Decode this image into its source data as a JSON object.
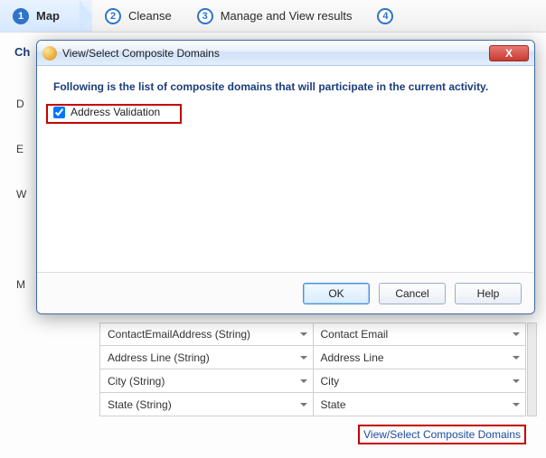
{
  "wizard": {
    "steps": [
      {
        "num": "1",
        "label": "Map"
      },
      {
        "num": "2",
        "label": "Cleanse"
      },
      {
        "num": "3",
        "label": "Manage and View results"
      },
      {
        "num": "4",
        "label": ""
      }
    ]
  },
  "section_title_prefix": "Ch",
  "side_labels": [
    "D",
    "E",
    "W",
    "",
    "M"
  ],
  "table_rows": [
    {
      "source": "ContactEmailAddress (String)",
      "domain": "Contact Email"
    },
    {
      "source": "Address Line (String)",
      "domain": "Address Line"
    },
    {
      "source": "City (String)",
      "domain": "City"
    },
    {
      "source": "State (String)",
      "domain": "State"
    }
  ],
  "link_button": "View/Select Composite Domains",
  "dialog": {
    "title": "View/Select Composite Domains",
    "instruction": "Following is the list of composite domains that will participate in the current activity.",
    "items": [
      {
        "label": "Address Validation",
        "checked": true
      }
    ],
    "buttons": {
      "ok": "OK",
      "cancel": "Cancel",
      "help": "Help"
    },
    "close": "X"
  }
}
